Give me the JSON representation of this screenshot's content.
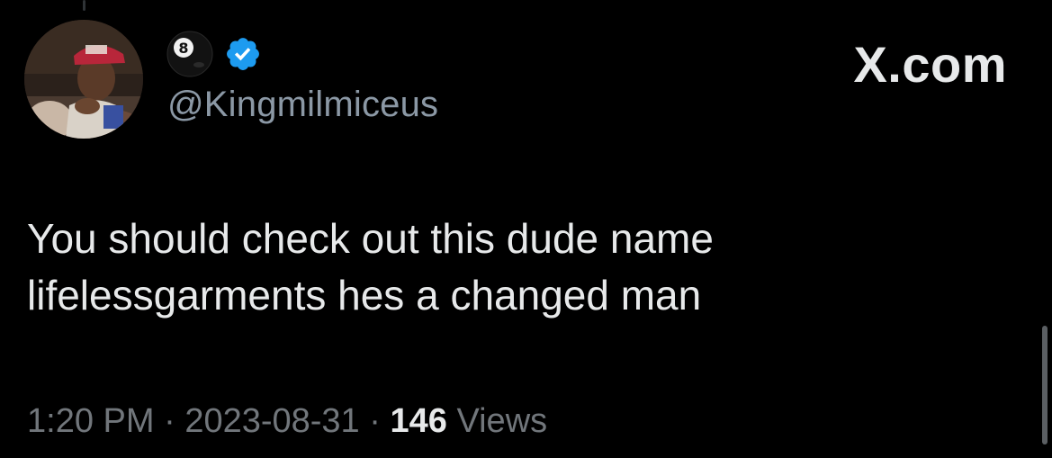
{
  "tweet": {
    "handle": "@Kingmilmiceus",
    "emoji": "8",
    "brand": "X.com",
    "text_lines": [
      "You should check out this dude name",
      "lifelessgarments hes a changed man"
    ],
    "time": "1:20 PM",
    "date": "2023-08-31",
    "separator": "·",
    "views_count": "146",
    "views_label": "Views"
  },
  "colors": {
    "background": "#000000",
    "text_primary": "#e7e9ea",
    "text_secondary": "#71767b",
    "verified_blue": "#1d9bf0"
  },
  "icons": {
    "emoji": "pool-8-ball-icon",
    "verified": "verified-badge-icon",
    "avatar": "user-avatar-photo"
  }
}
